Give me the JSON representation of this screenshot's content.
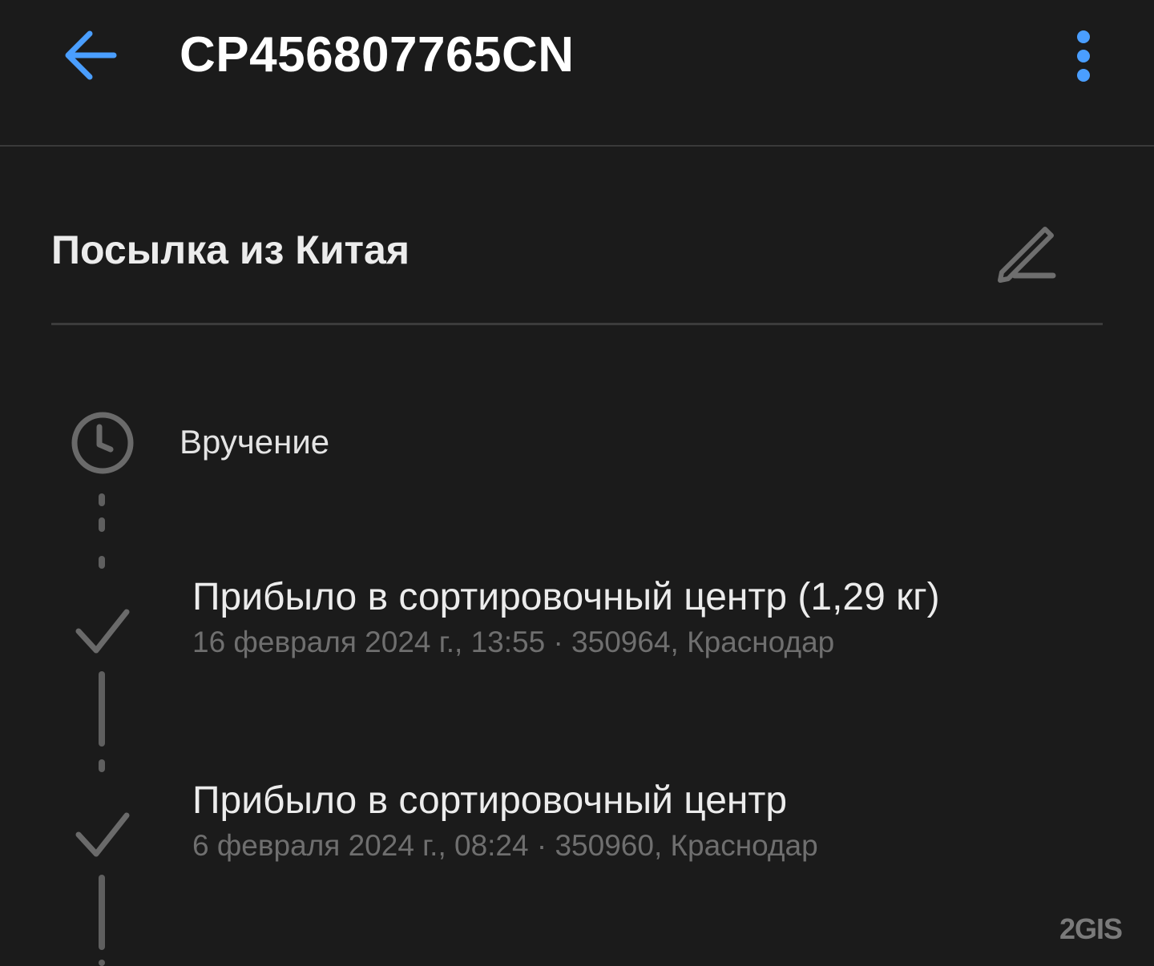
{
  "header": {
    "title": "CP456807765CN",
    "back_icon": "arrow-left-icon",
    "menu_icon": "more-vertical-icon",
    "accent_color": "#4a9eff"
  },
  "parcel": {
    "name": "Посылка из Китая",
    "edit_icon": "pencil-icon"
  },
  "status": {
    "label": "Вручение",
    "icon": "clock-icon"
  },
  "events": [
    {
      "title": "Прибыло в сортировочный центр (1,29 кг)",
      "meta": "16 февраля 2024 г., 13:55 · 350964, Краснодар",
      "icon": "check-icon"
    },
    {
      "title": "Прибыло в сортировочный центр",
      "meta": "6 февраля 2024 г., 08:24 · 350960, Краснодар",
      "icon": "check-icon"
    }
  ],
  "watermark": "2GIS"
}
